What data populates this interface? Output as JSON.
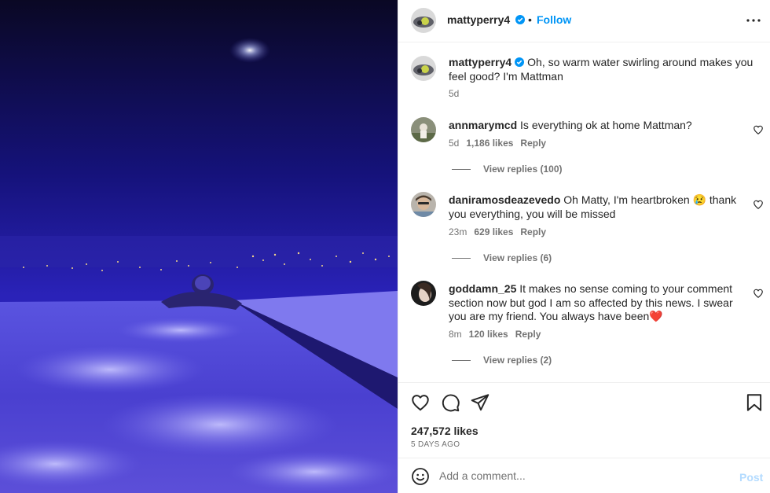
{
  "post": {
    "username": "mattyperry4",
    "follow_label": "Follow",
    "caption": "Oh, so warm water swirling around makes you feel good? I'm Mattman",
    "caption_time": "5d",
    "likes": "247,572 likes",
    "date": "5 DAYS AGO"
  },
  "comments": [
    {
      "username": "annmarymcd",
      "text": "Is everything ok at home Mattman?",
      "time": "5d",
      "likes": "1,186 likes",
      "reply_label": "Reply",
      "view_replies": "View replies (100)"
    },
    {
      "username": "daniramosdeazevedo",
      "text": "Oh Matty, I'm heartbroken 😢 thank you everything, you will be missed",
      "time": "23m",
      "likes": "629 likes",
      "reply_label": "Reply",
      "view_replies": "View replies (6)"
    },
    {
      "username": "goddamn_25",
      "text": "It makes no sense coming to your comment section now but god I am so affected by this news. I swear you are my friend. You always have been❤️",
      "time": "8m",
      "likes": "120 likes",
      "reply_label": "Reply",
      "view_replies": "View replies (2)"
    }
  ],
  "add_comment": {
    "placeholder": "Add a comment...",
    "post_label": "Post"
  },
  "icons": {
    "more": "more-options-icon",
    "like": "heart-icon",
    "comment": "comment-icon",
    "share": "share-icon",
    "save": "bookmark-icon",
    "emoji": "emoji-icon",
    "verified": "verified-badge-icon"
  },
  "colors": {
    "link": "#0095f6",
    "secondary_text": "#737373",
    "post_disabled": "#b3dbff",
    "heart_emoji": "#e8433e"
  }
}
